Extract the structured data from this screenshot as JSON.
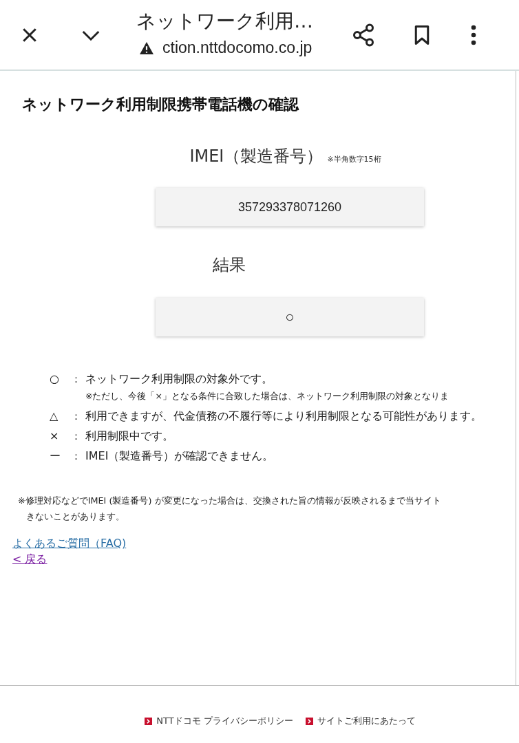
{
  "browser_bar": {
    "title": "ネットワーク利用…",
    "url": "ction.nttdocomo.co.jp",
    "insecure": true
  },
  "page": {
    "heading": "ネットワーク利用制限携帯電話機の確認",
    "imei_label": "IMEI（製造番号）",
    "imei_note": "※半角数字15桁",
    "imei_value": "357293378071260",
    "result_label": "結果",
    "result_value": "○",
    "legend": [
      {
        "symbol": "○",
        "colon": "：",
        "text": "ネットワーク利用制限の対象外です。",
        "note": "※ただし、今後「×」となる条件に合致した場合は、ネットワーク利用制限の対象となりま"
      },
      {
        "symbol": "△",
        "colon": "：",
        "text": "利用できますが、代金債務の不履行等により利用制限となる可能性があります。"
      },
      {
        "symbol": "×",
        "colon": "：",
        "text": "利用制限中です。"
      },
      {
        "symbol": "ー",
        "colon": "：",
        "text": "IMEI（製造番号）が確認できません。"
      }
    ],
    "footnote": [
      "※修理対応などでIMEI (製造番号) が変更になった場合は、交換された旨の情報が反映されるまで当サイト",
      "きないことがあります。"
    ],
    "links": [
      {
        "label": "よくあるご質問（FAQ)",
        "visited": false
      },
      {
        "label": "< 戻る",
        "visited": true
      }
    ]
  },
  "footer": {
    "links": [
      "NTTドコモ プライバシーポリシー",
      "サイトご利用にあたって"
    ]
  }
}
